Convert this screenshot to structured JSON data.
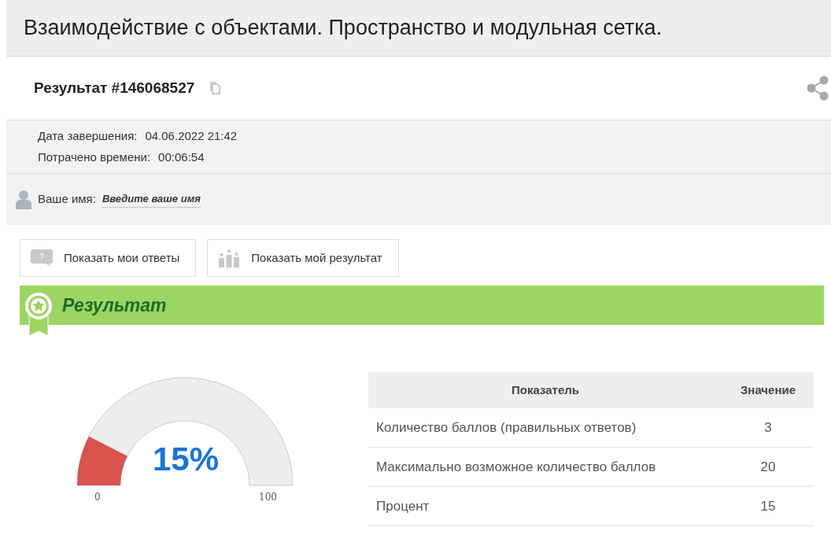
{
  "page_title": "Взаимодействие с объектами. Пространство и модульная сетка.",
  "result_header": {
    "title": "Результат #146068527"
  },
  "details": [
    {
      "label": "Дата завершения:",
      "value": "04.06.2022 21:42"
    },
    {
      "label": "Потрачено времени:",
      "value": "00:06:54"
    }
  ],
  "name_row": {
    "label": "Ваше имя:",
    "link": "Введите ваше имя"
  },
  "buttons": [
    {
      "kind": "answers",
      "label": "Показать мои ответы",
      "icon_text": "?"
    },
    {
      "kind": "result",
      "label": "Показать мой результат"
    }
  ],
  "result": {
    "heading": "Результат",
    "gauge": {
      "value_label": "15%",
      "min_label": "0",
      "max_label": "100"
    },
    "table": {
      "columns": [
        "Показатель",
        "Значение"
      ],
      "rows": [
        [
          "Количество баллов (правильных ответов)",
          "3"
        ],
        [
          "Максимально возможное количество баллов",
          "20"
        ],
        [
          "Процент",
          "15"
        ]
      ]
    }
  }
}
